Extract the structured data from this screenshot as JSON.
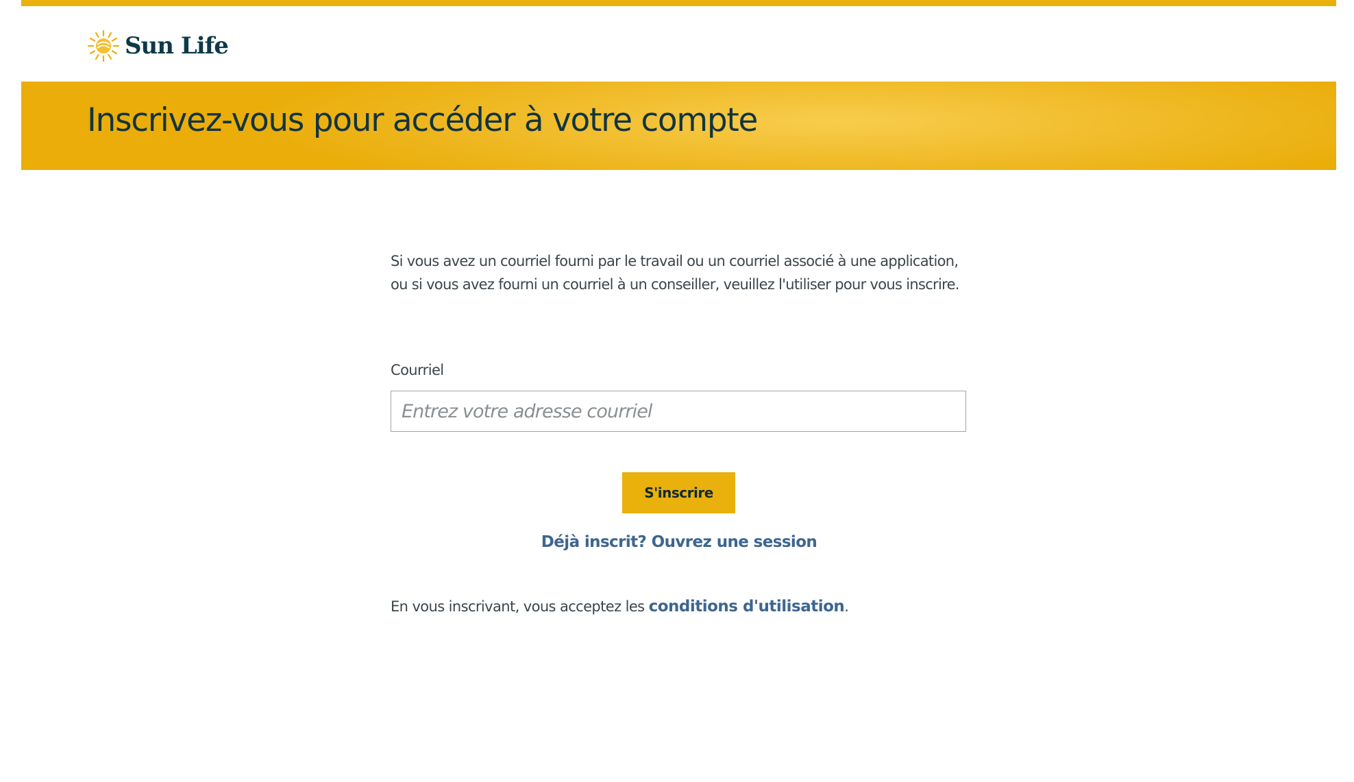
{
  "brand": {
    "name": "Sun Life",
    "logo_icon": "sun-logo-icon",
    "accent_color": "#eab00c",
    "text_color": "#12343f",
    "link_color": "#3d6590"
  },
  "banner": {
    "title": "Inscrivez-vous pour accéder à votre compte"
  },
  "form": {
    "intro": "Si vous avez un courriel fourni par le travail ou un courriel associé à une application, ou si vous avez fourni un courriel à un conseiller, veuillez l'utiliser pour vous inscrire.",
    "email_label": "Courriel",
    "email_placeholder": "Entrez votre adresse courriel",
    "email_value": "",
    "submit_label": "S'inscrire",
    "login_link": "Déjà inscrit? Ouvrez une session"
  },
  "terms": {
    "prefix": "En vous inscrivant, vous acceptez les ",
    "link_label": "conditions d'utilisation",
    "suffix": "."
  }
}
